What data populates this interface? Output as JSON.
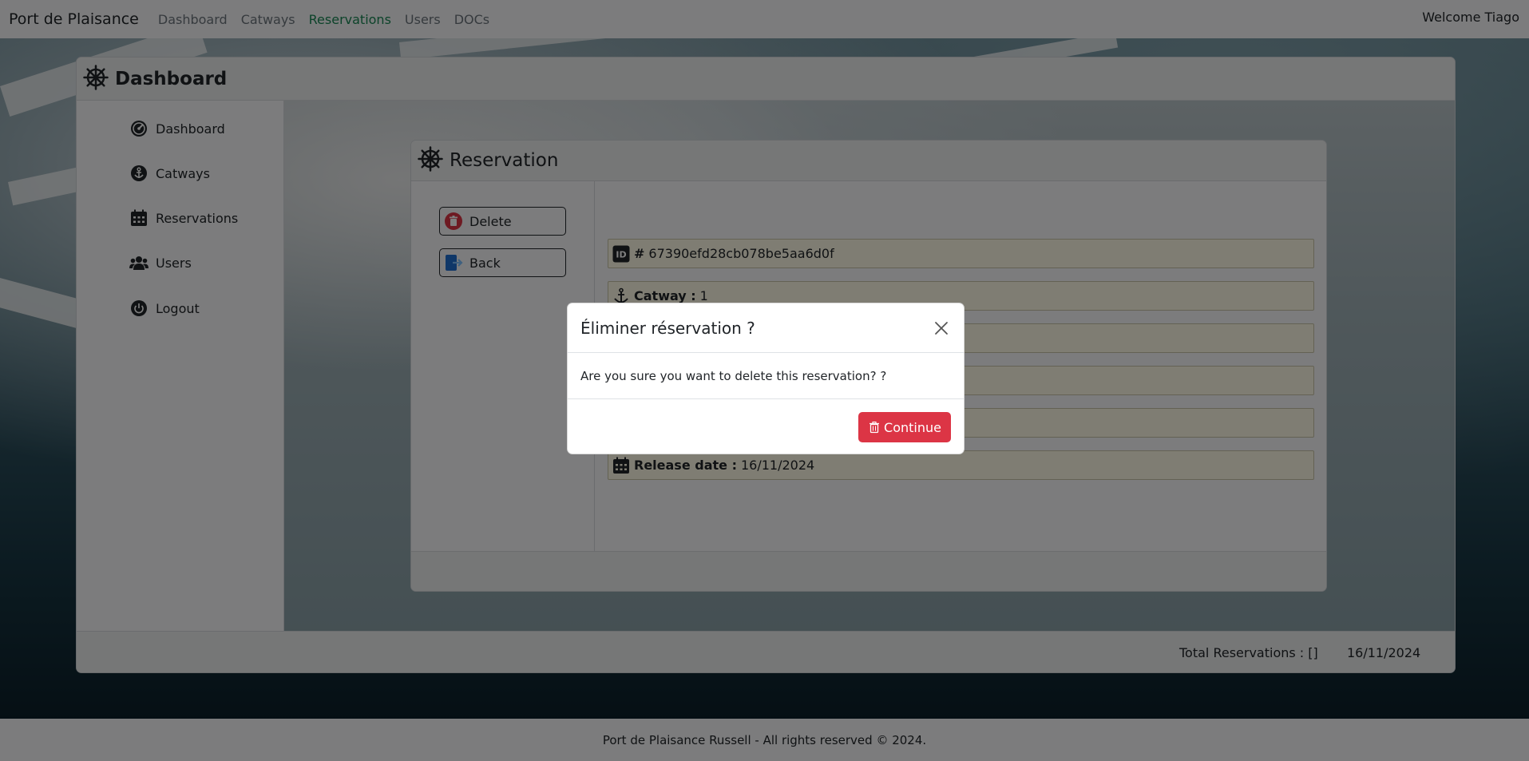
{
  "navbar": {
    "brand": "Port de Plaisance",
    "links": [
      "Dashboard",
      "Catways",
      "Reservations",
      "Users",
      "DOCs"
    ],
    "active": "Reservations",
    "welcome": "Welcome Tiago"
  },
  "dashboard": {
    "title": "Dashboard",
    "sidebar": [
      {
        "label": "Dashboard",
        "icon": "dashboard-gauge-icon"
      },
      {
        "label": "Catways",
        "icon": "anchor-icon"
      },
      {
        "label": "Reservations",
        "icon": "calendar-icon"
      },
      {
        "label": "Users",
        "icon": "users-icon"
      },
      {
        "label": "Logout",
        "icon": "power-icon"
      }
    ],
    "footer": {
      "total": "Total Reservations : []",
      "date": "16/11/2024"
    }
  },
  "reservation": {
    "title": "Reservation",
    "buttons": {
      "delete": "Delete",
      "back": "Back"
    },
    "fields": {
      "id": {
        "label": "#",
        "value": "67390efd28cb078be5aa6d0f"
      },
      "catway": {
        "label": "Catway :",
        "value": "1"
      },
      "release": {
        "label": "Release date :",
        "value": "16/11/2024"
      }
    }
  },
  "modal": {
    "title": "Éliminer réservation ?",
    "body": "Are you sure you want to delete this reservation? ?",
    "continue": "Continue"
  },
  "page_footer": "Port de Plaisance Russell - All rights reserved © 2024.",
  "colors": {
    "accent_green": "#198754",
    "danger": "#dc3545",
    "field_bg": "#fffbe6"
  }
}
